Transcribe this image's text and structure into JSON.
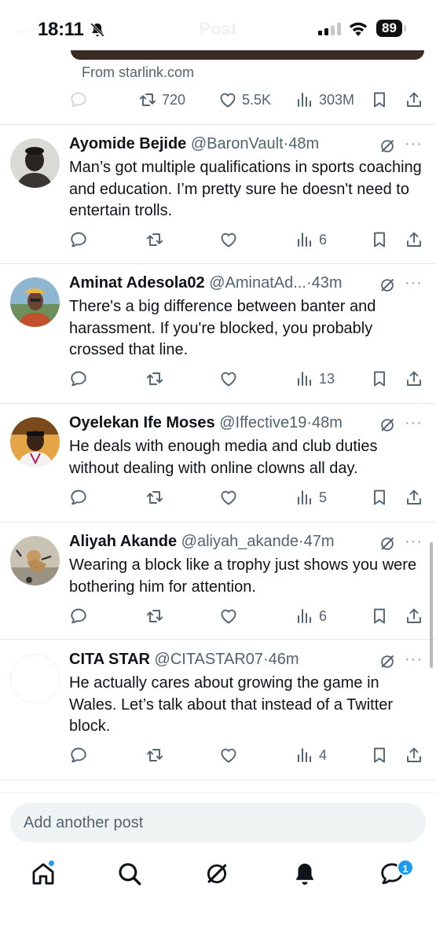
{
  "status_bar": {
    "time": "18:11",
    "battery": "89",
    "ghost_title": "Post"
  },
  "top_post": {
    "link_source": "From starlink.com",
    "reposts": "720",
    "likes": "5.5K",
    "views": "303M"
  },
  "replies": [
    {
      "name": "Ayomide Bejide",
      "handle": "@BaronVault",
      "time": "48m",
      "text": "Man’s got multiple qualifications in sports coaching and education. I’m pretty sure he doesn't need to entertain trolls.",
      "views": "6",
      "avatar_icon": "avatar-ayomide"
    },
    {
      "name": "Aminat Adesola02",
      "handle": "@AminatAd...",
      "time": "43m",
      "text": "There's a big difference between banter and harassment. If you're blocked, you probably crossed that line.",
      "views": "13",
      "avatar_icon": "avatar-aminat"
    },
    {
      "name": "Oyelekan Ife Moses",
      "handle": "@Iffective19",
      "time": "48m",
      "text": "He deals with enough media and club duties without dealing with online clowns all day.",
      "views": "5",
      "avatar_icon": "avatar-oyelekan"
    },
    {
      "name": "Aliyah Akande",
      "handle": "@aliyah_akande",
      "time": "47m",
      "text": "Wearing a block like a trophy just shows you were bothering him for attention.",
      "views": "6",
      "avatar_icon": "avatar-aliyah"
    },
    {
      "name": "CITA STAR",
      "handle": "@CITASTAR07",
      "time": "46m",
      "text": "He actually cares about growing the game in Wales. Let’s talk about that instead of a Twitter block.",
      "views": "4",
      "avatar_icon": "avatar-cita"
    }
  ],
  "composer": {
    "placeholder": "Add another post"
  },
  "bottom_nav": {
    "items": [
      "home-icon",
      "search-icon",
      "grok-icon",
      "notifications-icon",
      "messages-icon"
    ],
    "messages_badge": "1"
  },
  "colors": {
    "accent": "#1d9bf0",
    "text": "#0f1419",
    "muted": "#536471",
    "divider": "#e7e9ea"
  }
}
